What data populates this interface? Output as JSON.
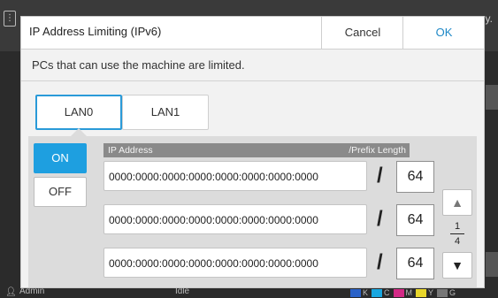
{
  "background": {
    "right_text": "y.",
    "status": {
      "user": "Admin",
      "state": "Idle",
      "inks": [
        {
          "label": "K",
          "color": "#2a62c9"
        },
        {
          "label": "C",
          "color": "#19a7e0"
        },
        {
          "label": "M",
          "color": "#d32a86"
        },
        {
          "label": "Y",
          "color": "#e8d62b"
        },
        {
          "label": "G",
          "color": "#777777"
        }
      ]
    }
  },
  "dialog": {
    "title": "IP Address Limiting (IPv6)",
    "cancel_label": "Cancel",
    "ok_label": "OK",
    "message": "PCs that can use the machine are limited.",
    "tabs": [
      {
        "label": "LAN0",
        "selected": true
      },
      {
        "label": "LAN1",
        "selected": false
      }
    ],
    "toggle": {
      "on_label": "ON",
      "off_label": "OFF",
      "selected": "ON"
    },
    "table": {
      "header_ip": "IP Address",
      "header_prefix": "/Prefix Length",
      "rows": [
        {
          "ip": "0000:0000:0000:0000:0000:0000:0000:0000",
          "prefix": "64"
        },
        {
          "ip": "0000:0000:0000:0000:0000:0000:0000:0000",
          "prefix": "64"
        },
        {
          "ip": "0000:0000:0000:0000:0000:0000:0000:0000",
          "prefix": "64"
        }
      ],
      "slash": "/"
    },
    "pager": {
      "up": "▲",
      "down": "▼",
      "current": "1",
      "total": "4"
    }
  }
}
